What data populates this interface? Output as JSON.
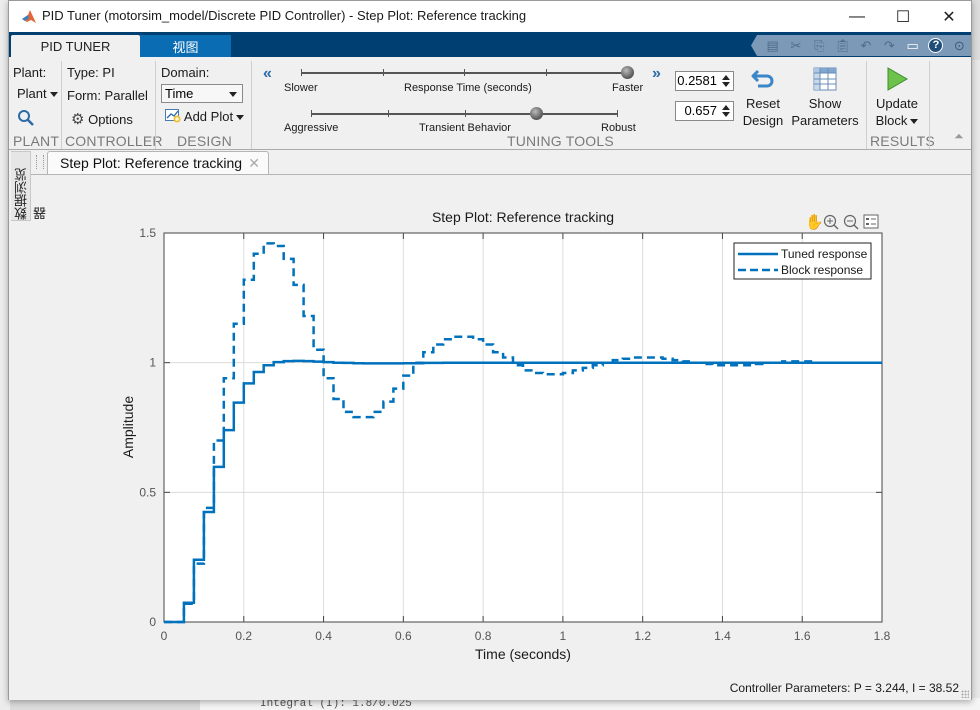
{
  "window": {
    "title": "PID Tuner (motorsim_model/Discrete PID Controller) - Step Plot: Reference tracking",
    "controls": {
      "minimize": "—",
      "maximize": "☐",
      "close": "✕"
    }
  },
  "ribbon_tabs": [
    {
      "label": "PID TUNER",
      "active": true
    },
    {
      "label": "视图",
      "active": false
    }
  ],
  "quick_access": [
    "save-icon",
    "cut-icon",
    "copy-icon",
    "paste-icon",
    "undo-icon",
    "redo-icon",
    "window-layout-icon",
    "help-icon",
    "more-icon"
  ],
  "ribbon": {
    "plant": {
      "label": "Plant:",
      "dropdown": "Plant",
      "group": "PLANT"
    },
    "controller": {
      "type": "Type: PI",
      "form": "Form: Parallel",
      "options": "Options",
      "group": "CONTROLLER"
    },
    "design": {
      "domain_label": "Domain:",
      "domain_value": "Time",
      "add_plot": "Add Plot",
      "group": "DESIGN"
    },
    "tuning": {
      "response_time": {
        "left": "Slower",
        "center": "Response Time (seconds)",
        "right": "Faster",
        "position": 1.0,
        "value": "0.2581"
      },
      "transient": {
        "left": "Aggressive",
        "center": "Transient Behavior",
        "right": "Robust",
        "position": 0.657,
        "value": "0.657"
      },
      "reset_line1": "Reset",
      "reset_line2": "Design",
      "show_line1": "Show",
      "show_line2": "Parameters",
      "group": "TUNING TOOLS"
    },
    "results": {
      "update_line1": "Update",
      "update_line2": "Block",
      "group": "RESULTS"
    }
  },
  "side_panel": {
    "label": "数据浏览器"
  },
  "document_tab": {
    "label": "Step Plot: Reference tracking",
    "close": "✕"
  },
  "status_text": "Controller Parameters: P = 3.244, I = 38.52",
  "plot_toolbar": [
    "pan-icon",
    "zoom-in-icon",
    "zoom-out-icon",
    "legend-icon"
  ],
  "colors": {
    "series": "#0072bd",
    "ribbon_dark": "#003f72",
    "ribbon_tab": "#0a6db3"
  },
  "chart_data": {
    "type": "line",
    "title": "Step Plot: Reference tracking",
    "xlabel": "Time (seconds)",
    "ylabel": "Amplitude",
    "xlim": [
      0,
      1.8
    ],
    "ylim": [
      0,
      1.5
    ],
    "xticks": [
      "0",
      "0.2",
      "0.4",
      "0.6",
      "0.8",
      "1",
      "1.2",
      "1.4",
      "1.6",
      "1.8"
    ],
    "yticks": [
      "0",
      "0.5",
      "1",
      "1.5"
    ],
    "grid": true,
    "legend_position": "top-right",
    "step_period": 0.025,
    "series": [
      {
        "name": "Tuned response",
        "style": "solid",
        "staircase": true,
        "values": [
          0,
          0,
          0.074,
          0.24,
          0.424,
          0.598,
          0.74,
          0.846,
          0.92,
          0.964,
          0.99,
          1.002,
          1.006,
          1.007,
          1.006,
          1.004,
          1.002,
          1.0,
          0.999,
          0.998,
          0.997,
          0.997,
          0.997,
          0.997,
          0.998,
          0.998,
          0.999,
          0.999,
          1.0,
          1.0,
          1.0,
          1.0,
          1.0,
          1.0,
          1.0,
          1.0,
          1.0,
          1.0,
          1.0,
          1.0,
          1.0,
          1.0,
          1.0,
          1.0,
          1.0,
          1.0,
          1.0,
          1.0,
          1.0,
          1.0,
          1.0,
          1.0,
          1.0,
          1.0,
          1.0,
          1.0,
          1.0,
          1.0,
          1.0,
          1.0,
          1.0,
          1.0,
          1.0,
          1.0,
          1.0,
          1.0,
          1.0,
          1.0,
          1.0,
          1.0,
          1.0,
          1.0,
          1.0
        ]
      },
      {
        "name": "Block response",
        "style": "dashed",
        "staircase": true,
        "values": [
          0,
          0,
          0.07,
          0.225,
          0.44,
          0.7,
          0.94,
          1.15,
          1.32,
          1.42,
          1.46,
          1.45,
          1.4,
          1.3,
          1.18,
          1.05,
          0.94,
          0.86,
          0.81,
          0.79,
          0.79,
          0.81,
          0.85,
          0.9,
          0.95,
          1.0,
          1.04,
          1.07,
          1.09,
          1.1,
          1.1,
          1.09,
          1.07,
          1.04,
          1.02,
          0.99,
          0.97,
          0.96,
          0.955,
          0.955,
          0.96,
          0.97,
          0.98,
          0.99,
          1.0,
          1.01,
          1.015,
          1.02,
          1.02,
          1.02,
          1.015,
          1.01,
          1.005,
          1.0,
          0.995,
          0.99,
          0.99,
          0.99,
          0.99,
          0.995,
          1.0,
          1.0,
          1.005,
          1.005,
          1.005,
          1.0,
          1.0,
          1.0,
          1.0,
          1.0,
          1.0,
          1.0,
          1.0
        ]
      }
    ]
  }
}
